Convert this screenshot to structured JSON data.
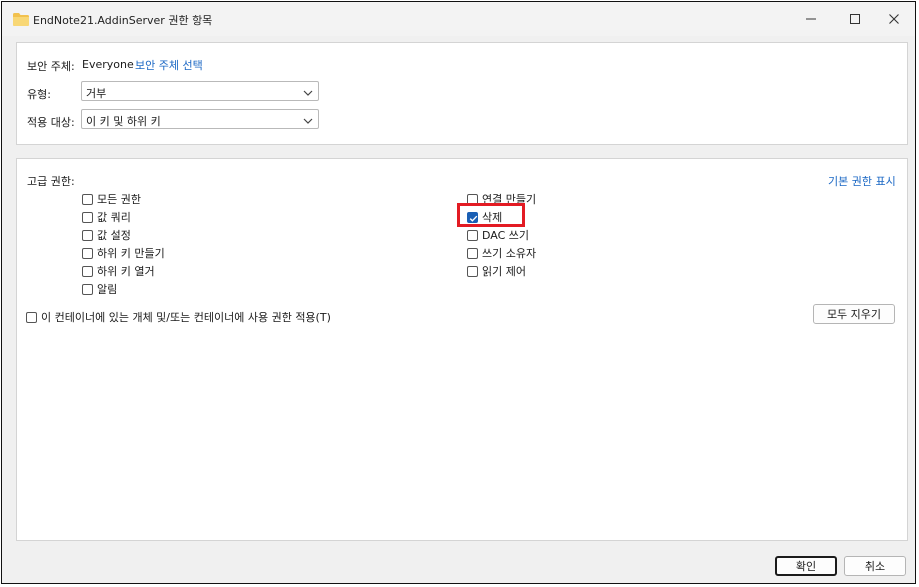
{
  "window": {
    "title": "EndNote21.AddinServer 권한 항목"
  },
  "principal": {
    "label": "보안 주체:",
    "value": "Everyone",
    "select_link": "보안 주체 선택"
  },
  "type": {
    "label": "유형:",
    "value": "거부"
  },
  "applies_to": {
    "label": "적용 대상:",
    "value": "이 키 및 하위 키"
  },
  "advanced": {
    "label": "고급 권한:",
    "show_basic_link": "기본 권한 표시",
    "left_permissions": [
      {
        "label": "모든 권한",
        "checked": false
      },
      {
        "label": "값 쿼리",
        "checked": false
      },
      {
        "label": "값 설정",
        "checked": false
      },
      {
        "label": "하위 키 만들기",
        "checked": false
      },
      {
        "label": "하위 키 열거",
        "checked": false
      },
      {
        "label": "알림",
        "checked": false
      }
    ],
    "right_permissions": [
      {
        "label": "연결 만들기",
        "checked": false
      },
      {
        "label": "삭제",
        "checked": true
      },
      {
        "label": "DAC 쓰기",
        "checked": false
      },
      {
        "label": "쓰기 소유자",
        "checked": false
      },
      {
        "label": "읽기 제어",
        "checked": false
      }
    ]
  },
  "apply_to_container": {
    "label": "이 컨테이너에 있는 개체 및/또는 컨테이너에 사용 권한 적용(T)",
    "checked": false
  },
  "buttons": {
    "clear_all": "모두 지우기",
    "ok": "확인",
    "cancel": "취소"
  },
  "colors": {
    "accent": "#1a5fb4",
    "link": "#1a67c4",
    "highlight": "#e31b23"
  }
}
